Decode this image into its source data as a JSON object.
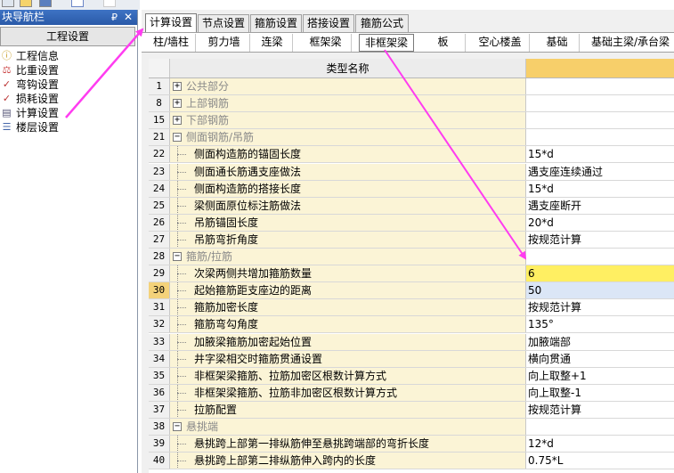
{
  "left_panel": {
    "title": "块导航栏",
    "pin": "₽",
    "close": "✕",
    "section_tab": "工程设置",
    "items": [
      {
        "label": "工程信息",
        "icon": "info-icon"
      },
      {
        "label": "比重设置",
        "icon": "weight-icon"
      },
      {
        "label": "弯钩设置",
        "icon": "hook-icon"
      },
      {
        "label": "损耗设置",
        "icon": "loss-icon"
      },
      {
        "label": "计算设置",
        "icon": "calc-icon"
      },
      {
        "label": "楼层设置",
        "icon": "floor-icon"
      }
    ]
  },
  "main": {
    "tabs": [
      "计算设置",
      "节点设置",
      "箍筋设置",
      "搭接设置",
      "箍筋公式"
    ],
    "sub_tabs": [
      "柱/墙柱",
      "剪力墙",
      "连梁",
      "框架梁",
      "非框架梁",
      "板",
      "空心楼盖",
      "基础",
      "基础主梁/承台梁"
    ],
    "grid_header": "类型名称",
    "rows": [
      {
        "num": "1",
        "type": "group",
        "expand": "+",
        "name": "公共部分",
        "value": ""
      },
      {
        "num": "8",
        "type": "group",
        "expand": "+",
        "name": "上部钢筋",
        "value": ""
      },
      {
        "num": "15",
        "type": "group",
        "expand": "+",
        "name": "下部钢筋",
        "value": ""
      },
      {
        "num": "21",
        "type": "group",
        "expand": "−",
        "name": "侧面钢筋/吊筋",
        "value": ""
      },
      {
        "num": "22",
        "type": "item",
        "name": "侧面构造筋的锚固长度",
        "value": "15*d"
      },
      {
        "num": "23",
        "type": "item",
        "name": "侧面通长筋遇支座做法",
        "value": "遇支座连续通过"
      },
      {
        "num": "24",
        "type": "item",
        "name": "侧面构造筋的搭接长度",
        "value": "15*d"
      },
      {
        "num": "25",
        "type": "item",
        "name": "梁侧面原位标注筋做法",
        "value": "遇支座断开"
      },
      {
        "num": "26",
        "type": "item",
        "name": "吊筋锚固长度",
        "value": "20*d"
      },
      {
        "num": "27",
        "type": "item",
        "name": "吊筋弯折角度",
        "value": "按规范计算"
      },
      {
        "num": "28",
        "type": "group",
        "expand": "−",
        "name": "箍筋/拉筋",
        "value": ""
      },
      {
        "num": "29",
        "type": "item",
        "name": "次梁两侧共增加箍筋数量",
        "value": "6"
      },
      {
        "num": "30",
        "type": "item",
        "name": "起始箍筋距支座边的距离",
        "value": "50"
      },
      {
        "num": "31",
        "type": "item",
        "name": "箍筋加密长度",
        "value": "按规范计算"
      },
      {
        "num": "32",
        "type": "item",
        "name": "箍筋弯勾角度",
        "value": "135°"
      },
      {
        "num": "33",
        "type": "item",
        "name": "加腋梁箍筋加密起始位置",
        "value": "加腋端部"
      },
      {
        "num": "34",
        "type": "item",
        "name": "井字梁相交时箍筋贯通设置",
        "value": "横向贯通"
      },
      {
        "num": "35",
        "type": "item",
        "name": "非框架梁箍筋、拉筋加密区根数计算方式",
        "value": "向上取整+1"
      },
      {
        "num": "36",
        "type": "item",
        "name": "非框架梁箍筋、拉筋非加密区根数计算方式",
        "value": "向上取整-1"
      },
      {
        "num": "37",
        "type": "item",
        "name": "拉筋配置",
        "value": "按规范计算"
      },
      {
        "num": "38",
        "type": "group",
        "expand": "−",
        "name": "悬挑端",
        "value": ""
      },
      {
        "num": "39",
        "type": "item",
        "name": "悬挑跨上部第一排纵筋伸至悬挑跨端部的弯折长度",
        "value": "12*d"
      },
      {
        "num": "40",
        "type": "item",
        "name": "悬挑跨上部第二排纵筋伸入跨内的长度",
        "value": "0.75*L"
      }
    ]
  },
  "colors": {
    "title_bar": "#2a5aa8",
    "header_value_col": "#f7cf6a",
    "name_col": "#fbf4d6",
    "selected_value": "#ffef62",
    "current_row_value": "#dbe6f6",
    "annotation_arrow": "#ff3cf0"
  }
}
